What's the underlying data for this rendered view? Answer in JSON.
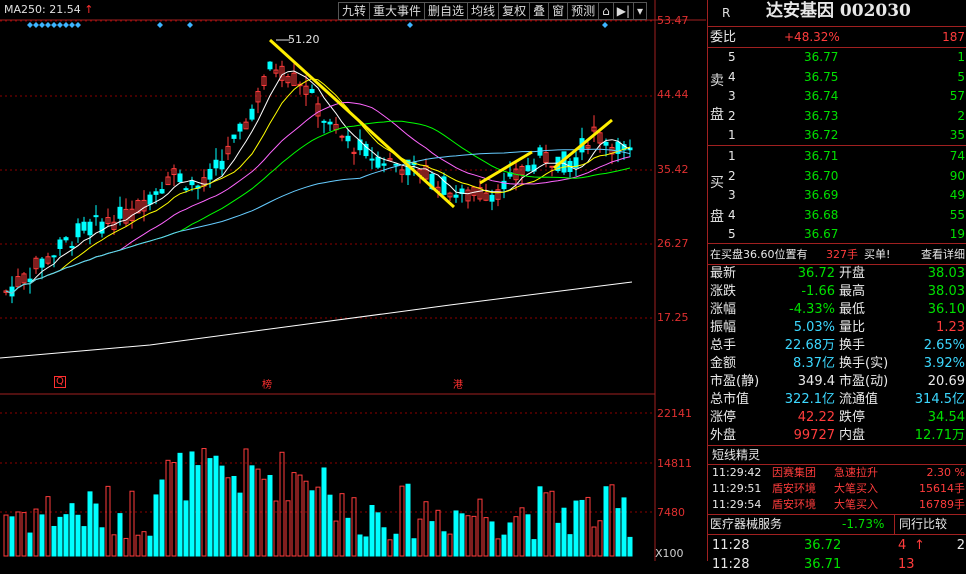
{
  "ma_label": {
    "text": "MA250: 21.54",
    "arrow": "↑"
  },
  "toolbar": [
    "九转",
    "重大事件",
    "删自选",
    "均线",
    "复权",
    "叠",
    "窗",
    "预测",
    "⌂",
    "▶|",
    "▾"
  ],
  "price_axis": [
    "53.47",
    "44.44",
    "35.42",
    "26.27",
    "17.25"
  ],
  "volume_axis": [
    "22141",
    "14811",
    "7480",
    "X100"
  ],
  "annotations": {
    "high": "51.20",
    "marker_q": "Q",
    "marker_bang": "榜",
    "marker_gang": "港"
  },
  "quote": {
    "r_label": "R",
    "stock_name": "达安基因 002030",
    "weibi": {
      "label": "委比",
      "value": "+48.32%",
      "count": "187"
    },
    "sell_label": [
      "卖",
      "盘"
    ],
    "sell": [
      {
        "level": "5",
        "price": "36.77",
        "vol": "1"
      },
      {
        "level": "4",
        "price": "36.75",
        "vol": "5"
      },
      {
        "level": "3",
        "price": "36.74",
        "vol": "57"
      },
      {
        "level": "2",
        "price": "36.73",
        "vol": "2"
      },
      {
        "level": "1",
        "price": "36.72",
        "vol": "35"
      }
    ],
    "buy_label": [
      "买",
      "盘"
    ],
    "buy": [
      {
        "level": "1",
        "price": "36.71",
        "vol": "74"
      },
      {
        "level": "2",
        "price": "36.70",
        "vol": "90"
      },
      {
        "level": "3",
        "price": "36.69",
        "vol": "49"
      },
      {
        "level": "4",
        "price": "36.68",
        "vol": "55"
      },
      {
        "level": "5",
        "price": "36.67",
        "vol": "19"
      }
    ],
    "order_note": {
      "text": "在买盘36.60位置有",
      "qty": "327手",
      "action": "买单!",
      "link": "查看详细"
    },
    "stats": [
      {
        "l1": "最新",
        "v1": "36.72",
        "c1": "green",
        "l2": "开盘",
        "v2": "38.03",
        "c2": "green"
      },
      {
        "l1": "涨跌",
        "v1": "-1.66",
        "c1": "green",
        "l2": "最高",
        "v2": "38.03",
        "c2": "green"
      },
      {
        "l1": "涨幅",
        "v1": "-4.33%",
        "c1": "green",
        "l2": "最低",
        "v2": "36.10",
        "c2": "green"
      },
      {
        "l1": "振幅",
        "v1": "5.03%",
        "c1": "cyan",
        "l2": "量比",
        "v2": "1.23",
        "c2": "red"
      },
      {
        "l1": "总手",
        "v1": "22.68万",
        "c1": "cyan",
        "l2": "换手",
        "v2": "2.65%",
        "c2": "cyan"
      },
      {
        "l1": "金额",
        "v1": "8.37亿",
        "c1": "cyan",
        "l2": "换手(实)",
        "v2": "3.92%",
        "c2": "cyan"
      },
      {
        "l1": "市盈(静)",
        "v1": "349.4",
        "c1": "white",
        "l2": "市盈(动)",
        "v2": "20.69",
        "c2": "white"
      },
      {
        "l1": "总市值",
        "v1": "322.1亿",
        "c1": "cyan",
        "l2": "流通值",
        "v2": "314.5亿",
        "c2": "cyan"
      },
      {
        "l1": "涨停",
        "v1": "42.22",
        "c1": "red",
        "l2": "跌停",
        "v2": "34.54",
        "c2": "green"
      },
      {
        "l1": "外盘",
        "v1": "99727",
        "c1": "red",
        "l2": "内盘",
        "v2": "12.71万",
        "c2": "green"
      }
    ],
    "elves_title": "短线精灵",
    "elves": [
      {
        "time": "11:29:42",
        "stock": "因赛集团",
        "event": "急速拉升",
        "value": "2.30 %"
      },
      {
        "time": "11:29:51",
        "stock": "盾安环境",
        "event": "大笔买入",
        "value": "15614手"
      },
      {
        "time": "11:29:54",
        "stock": "盾安环境",
        "event": "大笔买入",
        "value": "16789手"
      }
    ],
    "sector": {
      "name": "医疗器械服务",
      "change": "-1.73%",
      "compare": "同行比较"
    },
    "ticks": [
      {
        "time": "11:28",
        "price": "36.72",
        "vol": "4",
        "dir": "↑",
        "n": "2"
      },
      {
        "time": "11:28",
        "price": "36.71",
        "vol": "13",
        "dir": "",
        "n": ""
      }
    ]
  },
  "colors": {
    "up": "#ff3c3c",
    "down": "#00ffff",
    "bg": "#000000",
    "grid": "#8b0000"
  }
}
